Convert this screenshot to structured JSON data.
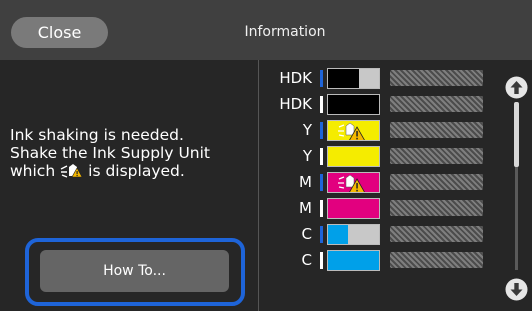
{
  "header": {
    "close_label": "Close",
    "title": "Information"
  },
  "message": {
    "line1": "Ink shaking is needed.",
    "line2": "Shake the Ink Supply Unit",
    "line3_before": "which",
    "line3_after": "is displayed."
  },
  "howto_label": "How To...",
  "inks": [
    {
      "label": "HDK",
      "color": "#000000",
      "level": 0.6,
      "mark": "#1e64d8",
      "warn": false
    },
    {
      "label": "HDK",
      "color": "#000000",
      "level": 1.0,
      "mark": "#ffffff",
      "warn": false
    },
    {
      "label": "Y",
      "color": "#f5ec00",
      "level": 1.0,
      "mark": "#1e64d8",
      "warn": true
    },
    {
      "label": "Y",
      "color": "#f5ec00",
      "level": 1.0,
      "mark": "#ffffff",
      "warn": false
    },
    {
      "label": "M",
      "color": "#e2007f",
      "level": 1.0,
      "mark": "#1e64d8",
      "warn": true
    },
    {
      "label": "M",
      "color": "#e2007f",
      "level": 1.0,
      "mark": "#ffffff",
      "warn": false
    },
    {
      "label": "C",
      "color": "#00a0e9",
      "level": 0.4,
      "mark": "#1e64d8",
      "warn": false
    },
    {
      "label": "C",
      "color": "#00a0e9",
      "level": 1.0,
      "mark": "#ffffff",
      "warn": false
    }
  ],
  "accent_color": "#1e64d8",
  "icons": {
    "scroll_up": "arrow-up-circle-icon",
    "scroll_down": "arrow-down-circle-icon",
    "shake_warning": "ink-shake-warning-icon"
  }
}
